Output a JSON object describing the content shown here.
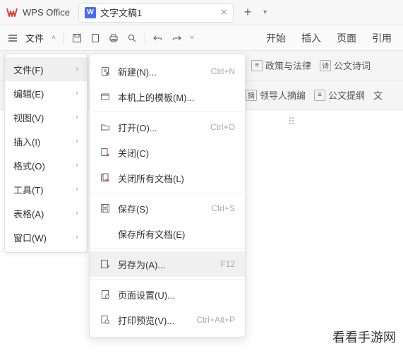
{
  "titleBar": {
    "appName": "WPS Office",
    "docTabIcon": "W",
    "docTabName": "文字文稿1"
  },
  "toolbar": {
    "fileLabel": "文件"
  },
  "ribbonTabs": [
    "开始",
    "插入",
    "页面",
    "引用"
  ],
  "secondaryRow1": [
    {
      "label": "政策与法律"
    },
    {
      "label": "公文诗词"
    }
  ],
  "secondaryRow2": [
    {
      "label": "领导人摘编"
    },
    {
      "label": "公文提纲"
    },
    {
      "label": "文"
    }
  ],
  "sideMenu": [
    {
      "label": "文件(F)",
      "active": true
    },
    {
      "label": "编辑(E)"
    },
    {
      "label": "视图(V)"
    },
    {
      "label": "插入(I)"
    },
    {
      "label": "格式(O)"
    },
    {
      "label": "工具(T)"
    },
    {
      "label": "表格(A)"
    },
    {
      "label": "窗口(W)"
    }
  ],
  "dropMenu": [
    {
      "icon": "new",
      "label": "新建(N)...",
      "shortcut": "Ctrl+N"
    },
    {
      "icon": "template",
      "label": "本机上的模板(M)...",
      "shortcut": ""
    },
    {
      "sep": true
    },
    {
      "icon": "open",
      "label": "打开(O)...",
      "shortcut": "Ctrl+O"
    },
    {
      "icon": "close",
      "label": "关闭(C)",
      "shortcut": ""
    },
    {
      "icon": "closeall",
      "label": "关闭所有文档(L)",
      "shortcut": ""
    },
    {
      "sep": true
    },
    {
      "icon": "save",
      "label": "保存(S)",
      "shortcut": "Ctrl+S"
    },
    {
      "icon": "",
      "label": "保存所有文档(E)",
      "shortcut": ""
    },
    {
      "sep": true
    },
    {
      "icon": "saveas",
      "label": "另存为(A)...",
      "shortcut": "F12",
      "hover": true
    },
    {
      "sep": true
    },
    {
      "icon": "pagesetup",
      "label": "页面设置(U)...",
      "shortcut": ""
    },
    {
      "icon": "preview",
      "label": "打印预览(V)...",
      "shortcut": "Ctrl+Alt+P"
    }
  ],
  "watermark": "看看手游网"
}
